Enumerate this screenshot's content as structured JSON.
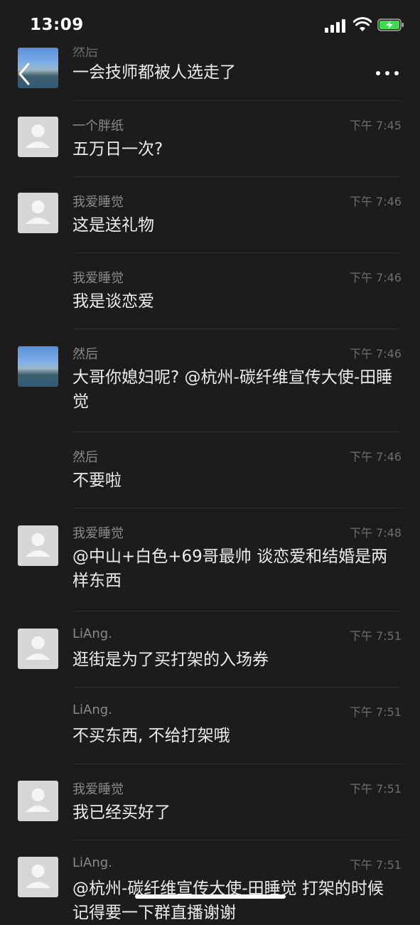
{
  "status_bar": {
    "time": "13:09"
  },
  "messages": [
    {
      "sender": "然后",
      "time": "",
      "text": "一会技师都被人选走了",
      "avatar": "photo"
    },
    {
      "sender": "一个胖纸",
      "time": "下午 7:45",
      "text": "五万日一次?",
      "avatar": "default"
    },
    {
      "sender": "我爱睡觉",
      "time": "下午 7:46",
      "text": "这是送礼物",
      "avatar": "default"
    },
    {
      "sender": "我爱睡觉",
      "time": "下午 7:46",
      "text": "我是谈恋爱",
      "avatar": "none"
    },
    {
      "sender": "然后",
      "time": "下午 7:46",
      "text": "大哥你媳妇呢? @杭州-碳纤维宣传大使-田睡觉",
      "avatar": "photo"
    },
    {
      "sender": "然后",
      "time": "下午 7:46",
      "text": "不要啦",
      "avatar": "none"
    },
    {
      "sender": "我爱睡觉",
      "time": "下午 7:48",
      "text": "@中山+白色+69哥最帅 谈恋爱和结婚是两样东西",
      "avatar": "default"
    },
    {
      "sender": "LiAng.",
      "time": "下午 7:51",
      "text": "逛街是为了买打架的入场券",
      "avatar": "default"
    },
    {
      "sender": "LiAng.",
      "time": "下午 7:51",
      "text": "不买东西, 不给打架哦",
      "avatar": "none"
    },
    {
      "sender": "我爱睡觉",
      "time": "下午 7:51",
      "text": "我已经买好了",
      "avatar": "default"
    },
    {
      "sender": "LiAng.",
      "time": "下午 7:51",
      "text": "@杭州-碳纤维宣传大使-田睡觉 打架的时候记得要一下群直播谢谢",
      "avatar": "default"
    }
  ]
}
